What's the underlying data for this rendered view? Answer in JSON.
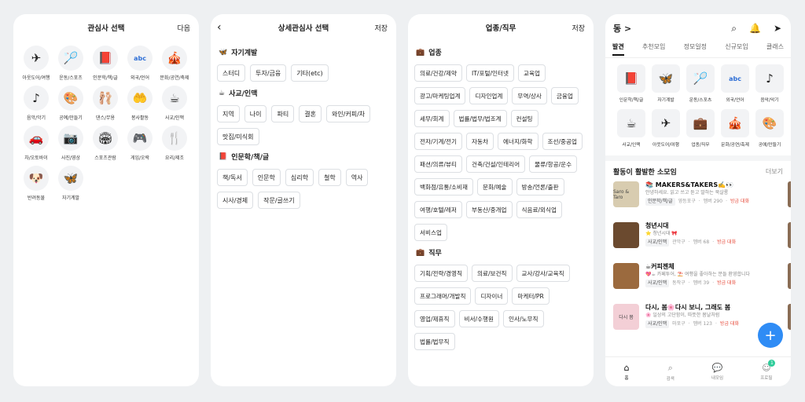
{
  "screen1": {
    "title": "관심사 선택",
    "next": "다음",
    "items": [
      {
        "label": "아웃도어/여행",
        "icon": "airplane-icon",
        "glyph": "✈"
      },
      {
        "label": "운동/스포츠",
        "icon": "racket-icon",
        "glyph": "🏸"
      },
      {
        "label": "인문학/책/글",
        "icon": "book-icon",
        "glyph": "📕"
      },
      {
        "label": "외국/언어",
        "icon": "abc-icon",
        "glyph": "abc"
      },
      {
        "label": "문화/공연/축제",
        "icon": "festival-icon",
        "glyph": "🎪"
      },
      {
        "label": "음악/악기",
        "icon": "music-note-icon",
        "glyph": "♪"
      },
      {
        "label": "공예/만들기",
        "icon": "palette-icon",
        "glyph": "🎨"
      },
      {
        "label": "댄스/무용",
        "icon": "ballet-shoes-icon",
        "glyph": "🩰"
      },
      {
        "label": "봉사활동",
        "icon": "heart-hands-icon",
        "glyph": "🤲"
      },
      {
        "label": "사교/인맥",
        "icon": "coffee-icon",
        "glyph": "☕"
      },
      {
        "label": "차/오토바이",
        "icon": "car-icon",
        "glyph": "🚗"
      },
      {
        "label": "사진/영상",
        "icon": "camera-icon",
        "glyph": "📷"
      },
      {
        "label": "스포츠관람",
        "icon": "stadium-icon",
        "glyph": "🏟"
      },
      {
        "label": "게임/오락",
        "icon": "gamepad-icon",
        "glyph": "🎮"
      },
      {
        "label": "요리/제조",
        "icon": "fork-knife-icon",
        "glyph": "🍴"
      },
      {
        "label": "반려동물",
        "icon": "dog-icon",
        "glyph": "🐶"
      },
      {
        "label": "자기계발",
        "icon": "butterfly-icon",
        "glyph": "🦋"
      }
    ]
  },
  "screen2": {
    "title": "상세관심사 선택",
    "save": "저장",
    "sections": [
      {
        "title": "자기계발",
        "icon": "butterfly-icon",
        "glyph": "🦋",
        "chips": [
          "스터디",
          "투자/금융",
          "기타(etc)"
        ]
      },
      {
        "title": "사교/인맥",
        "icon": "coffee-icon",
        "glyph": "☕",
        "chips": [
          "지역",
          "나이",
          "파티",
          "결혼",
          "와인/커피/차",
          "맛집/미식회"
        ]
      },
      {
        "title": "인문학/책/글",
        "icon": "book-icon",
        "glyph": "📕",
        "chips": [
          "책/독서",
          "인문학",
          "심리학",
          "철학",
          "역사",
          "시사/경제",
          "작문/글쓰기"
        ]
      }
    ]
  },
  "screen3": {
    "title": "업종/직무",
    "save": "저장",
    "sections": [
      {
        "title": "업종",
        "icon": "briefcase-icon",
        "glyph": "💼",
        "chips": [
          "의료/건강/제약",
          "IT/포털/인터넷",
          "교육업",
          "광고/마케팅업계",
          "디자인업계",
          "무역/상사",
          "금융업",
          "세무/회계",
          "법률/법무/법조계",
          "컨설팅",
          "전자/기계/전기",
          "자동차",
          "에너지/화학",
          "조선/중공업",
          "패션/의류/뷰티",
          "건축/건설/인테리어",
          "물류/항공/운수",
          "백화점/유통/소비재",
          "문화/예술",
          "방송/언론/출판",
          "여행/호텔/레저",
          "부동산/중개업",
          "식음료/외식업",
          "서비스업"
        ]
      },
      {
        "title": "직무",
        "icon": "briefcase-icon",
        "glyph": "💼",
        "chips": [
          "기획/전략/경영직",
          "의료/보건직",
          "교사/강사/교육직",
          "프로그래머/개발직",
          "디자이너",
          "마케터/PR",
          "영업/제휴직",
          "비서/수행원",
          "인사/노무직",
          "법률/법무직"
        ]
      }
    ]
  },
  "screen4": {
    "location": "동 >",
    "tabs": [
      "발견",
      "추천모임",
      "정모일정",
      "신규모임",
      "클래스"
    ],
    "categories": [
      {
        "label": "인문학/책/글",
        "icon": "book-icon",
        "glyph": "📕"
      },
      {
        "label": "자기계발",
        "icon": "butterfly-icon",
        "glyph": "🦋"
      },
      {
        "label": "운동/스포츠",
        "icon": "racket-icon",
        "glyph": "🏸"
      },
      {
        "label": "외국/언어",
        "icon": "abc-icon",
        "glyph": "abc"
      },
      {
        "label": "음악/악기",
        "icon": "music-note-icon",
        "glyph": "♪"
      },
      {
        "label": "사교/인맥",
        "icon": "coffee-icon",
        "glyph": "☕"
      },
      {
        "label": "아웃도어/여행",
        "icon": "airplane-icon",
        "glyph": "✈"
      },
      {
        "label": "업종/직무",
        "icon": "briefcase-icon",
        "glyph": "💼"
      },
      {
        "label": "문화/공연/축제",
        "icon": "festival-icon",
        "glyph": "🎪"
      },
      {
        "label": "공예/만들기",
        "icon": "palette-icon",
        "glyph": "🎨"
      }
    ],
    "section_title": "활동이 활발한 소모임",
    "more": "더보기",
    "meetups": [
      {
        "title": "📚 MAKERS&TAKERS✍️👀",
        "desc": "안녕하세요. 읽고 쓰고 듣고 말하는 북살롱",
        "tag": "인문학/책/글",
        "loc": "영등포구",
        "members": "멤버 290",
        "hot": "방금 대화",
        "thumb_text": "Saro & Taro",
        "thumb_color": "#d8ccb0"
      },
      {
        "title": "청년시대",
        "desc": "⭐ 청년시대 🎀",
        "tag": "사교/인맥",
        "loc": "관악구",
        "members": "멤버 68",
        "hot": "방금 대화",
        "thumb_text": "",
        "thumb_color": "#6b4a2f"
      },
      {
        "title": "☕커피젠체",
        "desc": "💖☕ 카페투어, ⛱️ 여행을 좋아하는 분들 환영합니다",
        "tag": "사교/인맥",
        "loc": "동작구",
        "members": "멤버 39",
        "hot": "방금 대화",
        "thumb_text": "",
        "thumb_color": "#9b6a3e"
      },
      {
        "title": "다시, 봄🌸다시 보니, 그래도 봄",
        "desc": "🌸 일상의 고단함이, 따뜻한 봄날처럼",
        "tag": "사교/인맥",
        "loc": "마포구",
        "members": "멤버 123",
        "hot": "방금 대화",
        "thumb_text": "다시 봄",
        "thumb_color": "#f3cfd6"
      }
    ],
    "fab": "+",
    "nav": [
      {
        "label": "홈",
        "icon": "home-icon",
        "glyph": "⌂"
      },
      {
        "label": "검색",
        "icon": "search-icon",
        "glyph": "⌕"
      },
      {
        "label": "내모임",
        "icon": "chat-bubbles-icon",
        "glyph": "💬"
      },
      {
        "label": "프로필",
        "icon": "profile-icon",
        "glyph": "☺"
      }
    ],
    "badge": "1"
  }
}
